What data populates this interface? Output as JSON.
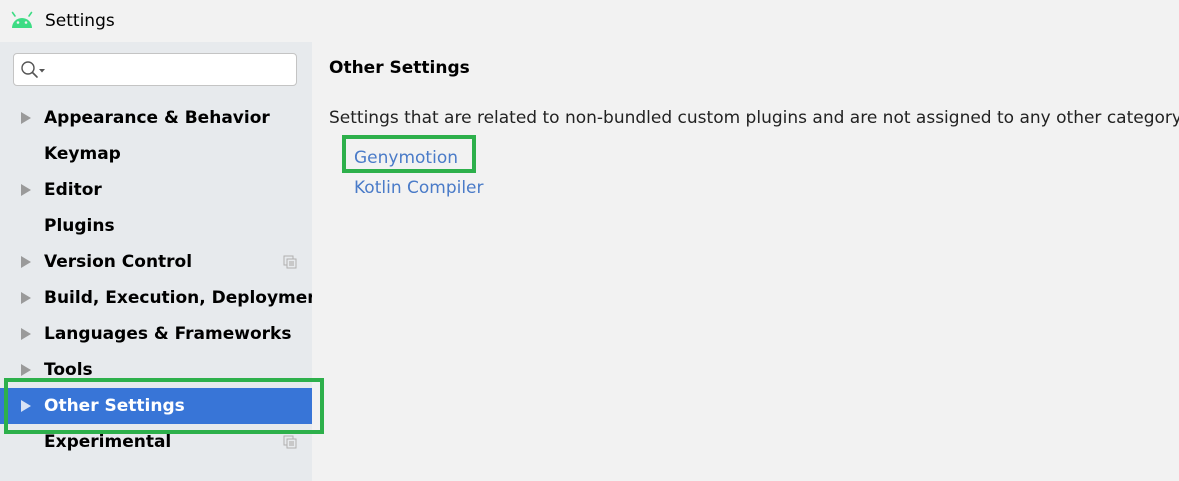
{
  "window": {
    "title": "Settings",
    "app_icon": "android-icon",
    "app_icon_color": "#3ddc84"
  },
  "sidebar": {
    "search": {
      "value": "",
      "placeholder": "",
      "icon": "search-icon"
    },
    "items": [
      {
        "label": "Appearance & Behavior",
        "has_arrow": true,
        "selected": false,
        "copy_icon": false
      },
      {
        "label": "Keymap",
        "has_arrow": false,
        "selected": false,
        "copy_icon": false
      },
      {
        "label": "Editor",
        "has_arrow": true,
        "selected": false,
        "copy_icon": false
      },
      {
        "label": "Plugins",
        "has_arrow": false,
        "selected": false,
        "copy_icon": false
      },
      {
        "label": "Version Control",
        "has_arrow": true,
        "selected": false,
        "copy_icon": true
      },
      {
        "label": "Build, Execution, Deployment",
        "has_arrow": true,
        "selected": false,
        "copy_icon": false
      },
      {
        "label": "Languages & Frameworks",
        "has_arrow": true,
        "selected": false,
        "copy_icon": false
      },
      {
        "label": "Tools",
        "has_arrow": true,
        "selected": false,
        "copy_icon": false
      },
      {
        "label": "Other Settings",
        "has_arrow": true,
        "selected": true,
        "copy_icon": false
      },
      {
        "label": "Experimental",
        "has_arrow": false,
        "selected": false,
        "copy_icon": true
      }
    ]
  },
  "main": {
    "title": "Other Settings",
    "description": "Settings that are related to non-bundled custom plugins and are not assigned to any other category.",
    "links": [
      {
        "label": "Genymotion"
      },
      {
        "label": "Kotlin Compiler"
      }
    ]
  },
  "colors": {
    "selection": "#3875d7",
    "link": "#4a7bc8",
    "highlight_frame": "#2db04b",
    "sidebar_bg": "#e7eaed",
    "content_bg": "#f2f2f2"
  }
}
